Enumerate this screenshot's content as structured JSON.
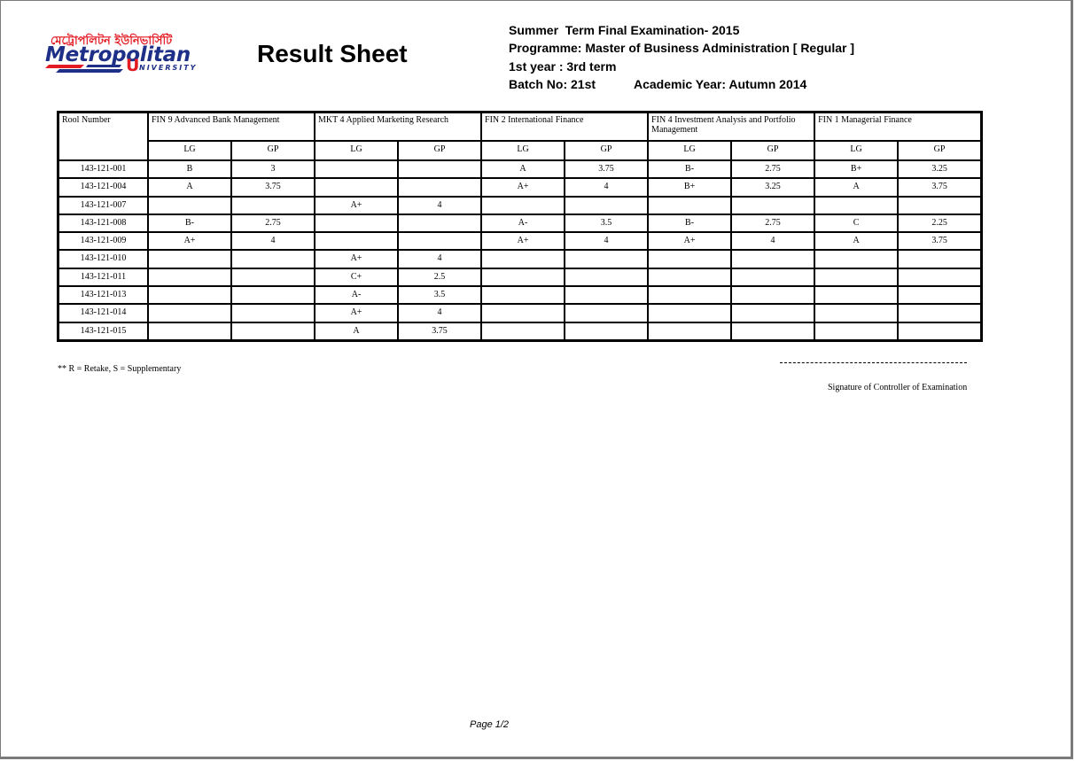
{
  "logo": {
    "bangla_text": "মেট্রোপলিটন ইউনিভার্সিটি",
    "name": "Metropolitan",
    "u_letter": "U",
    "university": "NIVERSITY",
    "colors": {
      "blue": "#1d2f86",
      "red": "#e31b23"
    }
  },
  "title": "Result Sheet",
  "header": {
    "exam": "Summer  Term Final Examination- 2015",
    "programme": "Programme: Master of Business Administration [ Regular ]",
    "year_term": "1st year : 3rd term",
    "batch": "Batch No: 21st",
    "academic_year": "Academic Year: Autumn 2014"
  },
  "table": {
    "roll_header": "Rool Number",
    "courses": [
      "FIN 9 Advanced Bank Management",
      "MKT 4 Applied Marketing Research",
      "FIN 2 International Finance",
      "FIN 4 Investment Analysis and Portfolio Management",
      "FIN 1 Managerial Finance"
    ],
    "sub_headers": [
      "LG",
      "GP",
      "LG",
      "GP",
      "LG",
      "GP",
      "LG",
      "GP",
      "LG",
      "GP"
    ],
    "rows": [
      {
        "roll": "143-121-001",
        "cells": [
          "B",
          "3",
          "",
          "",
          "A",
          "3.75",
          "B-",
          "2.75",
          "B+",
          "3.25"
        ]
      },
      {
        "roll": "143-121-004",
        "cells": [
          "A",
          "3.75",
          "",
          "",
          "A+",
          "4",
          "B+",
          "3.25",
          "A",
          "3.75"
        ]
      },
      {
        "roll": "143-121-007",
        "cells": [
          "",
          "",
          "A+",
          "4",
          "",
          "",
          "",
          "",
          "",
          ""
        ]
      },
      {
        "roll": "143-121-008",
        "cells": [
          "B-",
          "2.75",
          "",
          "",
          "A-",
          "3.5",
          "B-",
          "2.75",
          "C",
          "2.25"
        ]
      },
      {
        "roll": "143-121-009",
        "cells": [
          "A+",
          "4",
          "",
          "",
          "A+",
          "4",
          "A+",
          "4",
          "A",
          "3.75"
        ]
      },
      {
        "roll": "143-121-010",
        "cells": [
          "",
          "",
          "A+",
          "4",
          "",
          "",
          "",
          "",
          "",
          ""
        ]
      },
      {
        "roll": "143-121-011",
        "cells": [
          "",
          "",
          "C+",
          "2.5",
          "",
          "",
          "",
          "",
          "",
          ""
        ]
      },
      {
        "roll": "143-121-013",
        "cells": [
          "",
          "",
          "A-",
          "3.5",
          "",
          "",
          "",
          "",
          "",
          ""
        ]
      },
      {
        "roll": "143-121-014",
        "cells": [
          "",
          "",
          "A+",
          "4",
          "",
          "",
          "",
          "",
          "",
          ""
        ]
      },
      {
        "roll": "143-121-015",
        "cells": [
          "",
          "",
          "A",
          "3.75",
          "",
          "",
          "",
          "",
          "",
          ""
        ]
      }
    ]
  },
  "footer": {
    "note": "** R = Retake, S = Supplementary",
    "signature_label": "Signature of Controller of Examination",
    "page": "Page 1/2"
  }
}
